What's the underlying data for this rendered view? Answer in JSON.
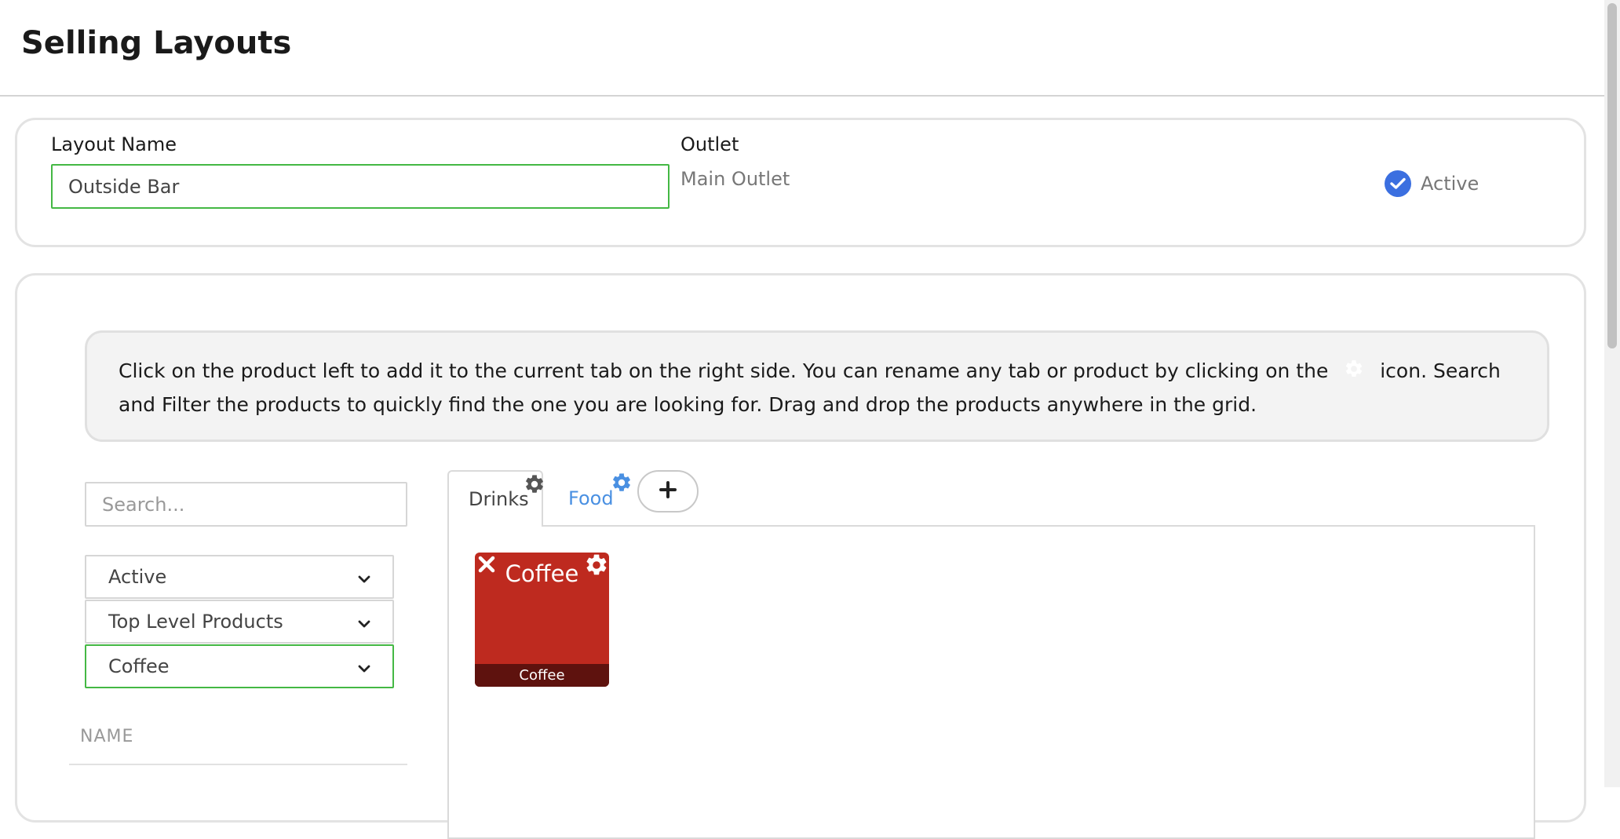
{
  "page": {
    "title": "Selling Layouts"
  },
  "layout_card": {
    "name_label": "Layout Name",
    "name_value": "Outside Bar",
    "outlet_label": "Outlet",
    "outlet_value": "Main Outlet",
    "active_label": "Active",
    "active_checked": true
  },
  "info": {
    "text_before_icon": "Click on the product left to add it to the current tab on the right side. You can rename any tab or product by clicking on the",
    "icon": "gear-icon",
    "text_after_icon": "icon. Search and Filter the products to quickly find the one you are looking for. Drag and drop the products anywhere in the grid."
  },
  "filters": {
    "search_placeholder": "Search...",
    "status_selected": "Active",
    "level_selected": "Top Level Products",
    "category_selected": "Coffee"
  },
  "product_list": {
    "name_header": "NAME"
  },
  "tabs": [
    {
      "label": "Drinks",
      "active": true
    },
    {
      "label": "Food",
      "active": false
    }
  ],
  "tiles": [
    {
      "title": "Coffee",
      "footer": "Coffee",
      "color": "#be2a1f"
    }
  ],
  "colors": {
    "accent_blue": "#4a90e2",
    "check_blue": "#3b6fe0",
    "valid_green": "#44b844",
    "tile_red": "#be2a1f"
  }
}
